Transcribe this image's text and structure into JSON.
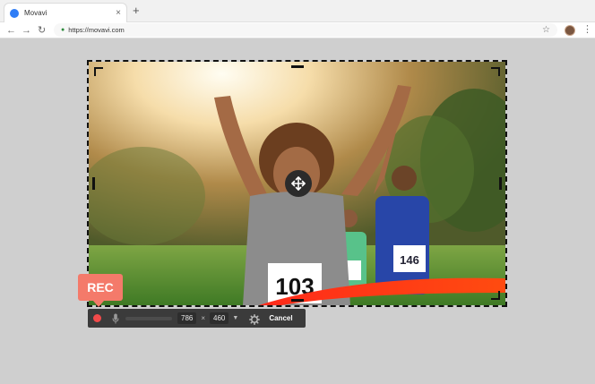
{
  "browser": {
    "tab_title": "Movavi",
    "tab_close": "×",
    "new_tab": "+",
    "url": "https://movavi.com",
    "icons": [
      "back-arrow-icon",
      "forward-arrow-icon",
      "reload-icon",
      "lock-icon",
      "star-icon",
      "profile-avatar",
      "menu-kebab-icon"
    ]
  },
  "photo": {
    "bib_main": "103",
    "bib_right": "146"
  },
  "controls": {
    "width": "786",
    "times": "×",
    "height": "460",
    "cancel_label": "Cancel"
  },
  "rec_badge": "REC",
  "colors": {
    "record": "#f24a4a",
    "rec_badge": "#f47a6a",
    "toolbar": "#3b3b3b",
    "background": "#cfcfcf"
  }
}
